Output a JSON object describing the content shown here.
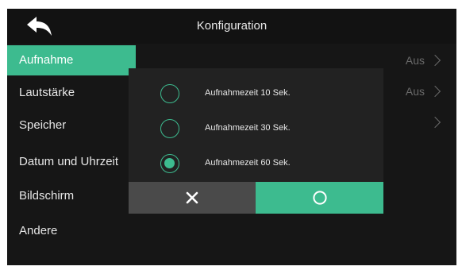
{
  "header": {
    "title": "Konfiguration",
    "back_icon": "back-arrow-icon"
  },
  "sidebar": {
    "items": [
      {
        "label": "Aufnahme",
        "active": true
      },
      {
        "label": "Lautstärke",
        "active": false
      },
      {
        "label": "Speicher",
        "active": false
      },
      {
        "label": "Datum und Uhrzeit",
        "active": false
      },
      {
        "label": "Bildschirm",
        "active": false
      },
      {
        "label": "Andere",
        "active": false
      }
    ]
  },
  "settings_rows": [
    {
      "value": "Aus",
      "icon": "chevron-right-icon"
    },
    {
      "value": "Aus",
      "icon": "chevron-right-icon"
    },
    {
      "value": "",
      "icon": "chevron-right-icon"
    }
  ],
  "dialog": {
    "options": [
      {
        "label": "Aufnahmezeit 10 Sek.",
        "checked": false
      },
      {
        "label": "Aufnahmezeit 30 Sek.",
        "checked": false
      },
      {
        "label": "Aufnahmezeit 60 Sek.",
        "checked": true
      }
    ],
    "cancel_icon": "close-icon",
    "confirm_icon": "circle-ok-icon"
  },
  "colors": {
    "accent": "#3dbb8f",
    "background": "#161616",
    "dialog": "#222222",
    "cancel": "#4a4a4a"
  }
}
